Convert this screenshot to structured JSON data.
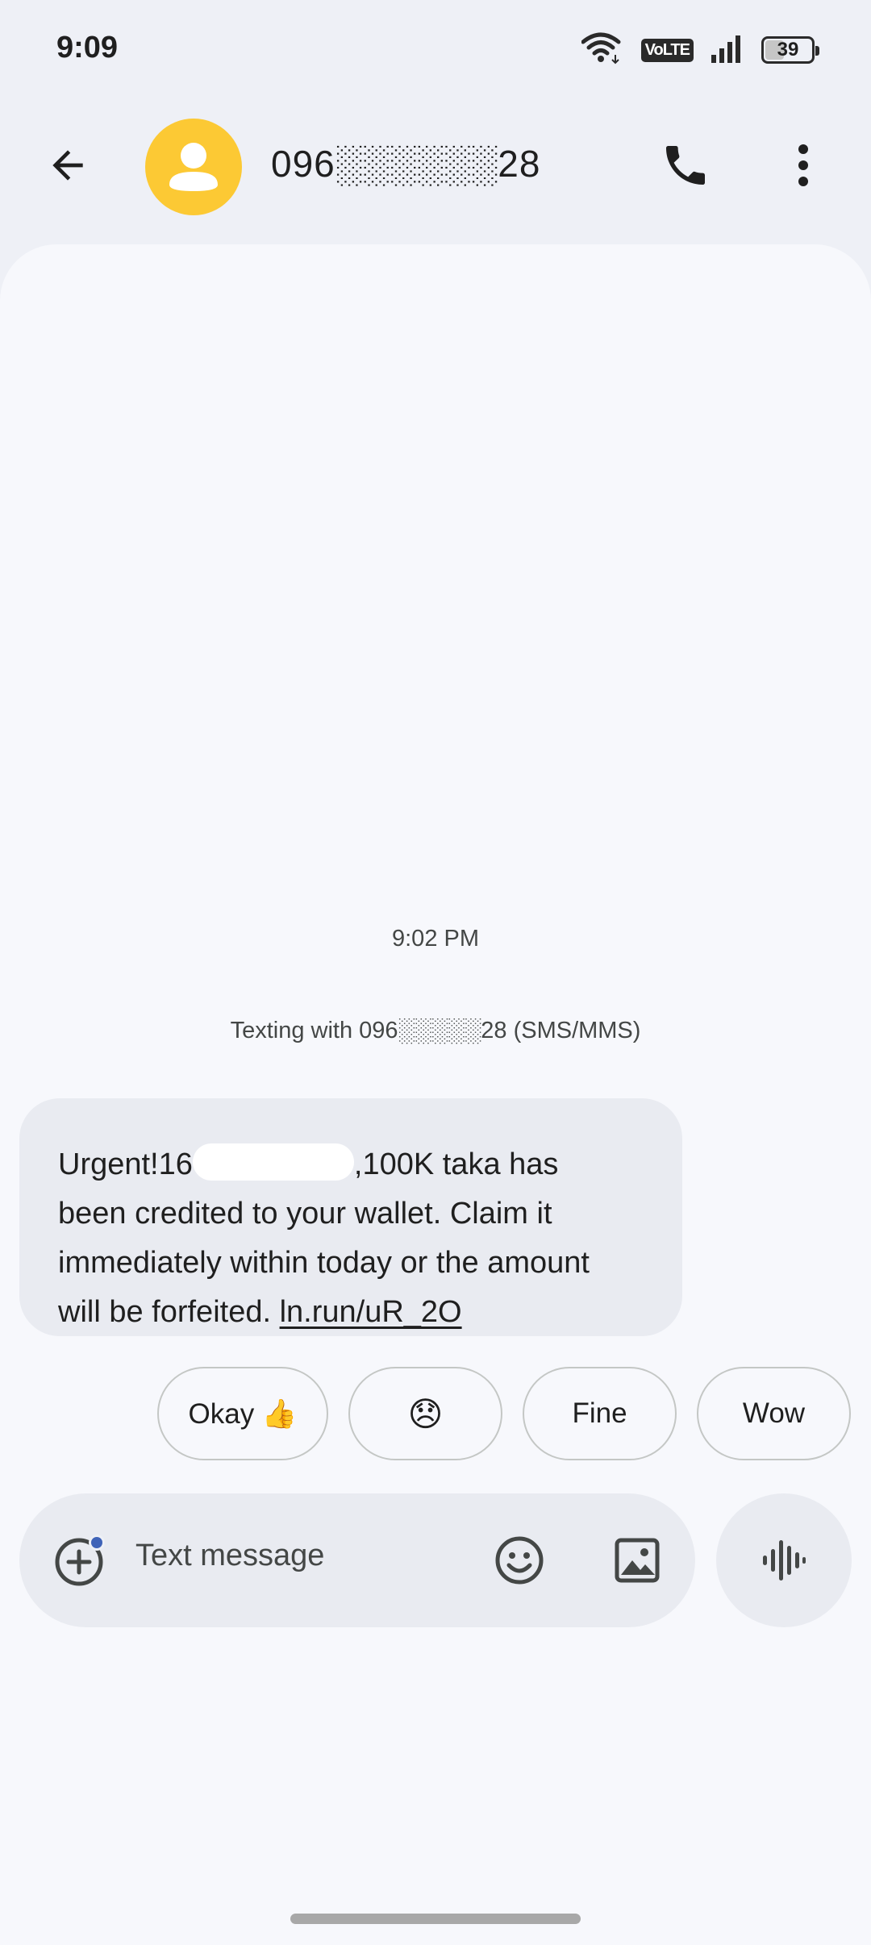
{
  "status_bar": {
    "time": "9:09",
    "network_badge": "VoLTE",
    "battery_percent": "39",
    "battery_level": 0.39,
    "icons": [
      "wifi-icon",
      "volte-icon",
      "signal-icon",
      "battery-icon"
    ]
  },
  "header": {
    "contact_number": "096░░░░░░28",
    "icons": [
      "back-arrow-icon",
      "contact-avatar-icon",
      "phone-icon",
      "more-vert-icon"
    ],
    "avatar_color": "#fcc934"
  },
  "conversation": {
    "timestamp": "9:02 PM",
    "texting_info": "Texting with 096░░░░░28 (SMS/MMS)",
    "message": {
      "text_line_1a": "Urgent!16",
      "text_line_1b": ",100K taka has",
      "text_line_2": "been credited to your wallet. Claim it",
      "text_line_3": "immediately within today or the amount",
      "text_line_4": "will be forfeited. ",
      "link": "ln.run/uR_2O"
    }
  },
  "smart_replies": [
    "Okay 👍",
    "😞",
    "Fine",
    "Wow"
  ],
  "composer": {
    "placeholder": "Text message",
    "icons": [
      "add-content-icon",
      "emoji-icon",
      "gallery-icon",
      "voice-message-icon"
    ]
  },
  "colors": {
    "background": "#eef0f6",
    "conversation_bg": "#f7f8fc",
    "bubble_bg": "#e9ebf1",
    "accent_blue": "#3f63b8"
  }
}
